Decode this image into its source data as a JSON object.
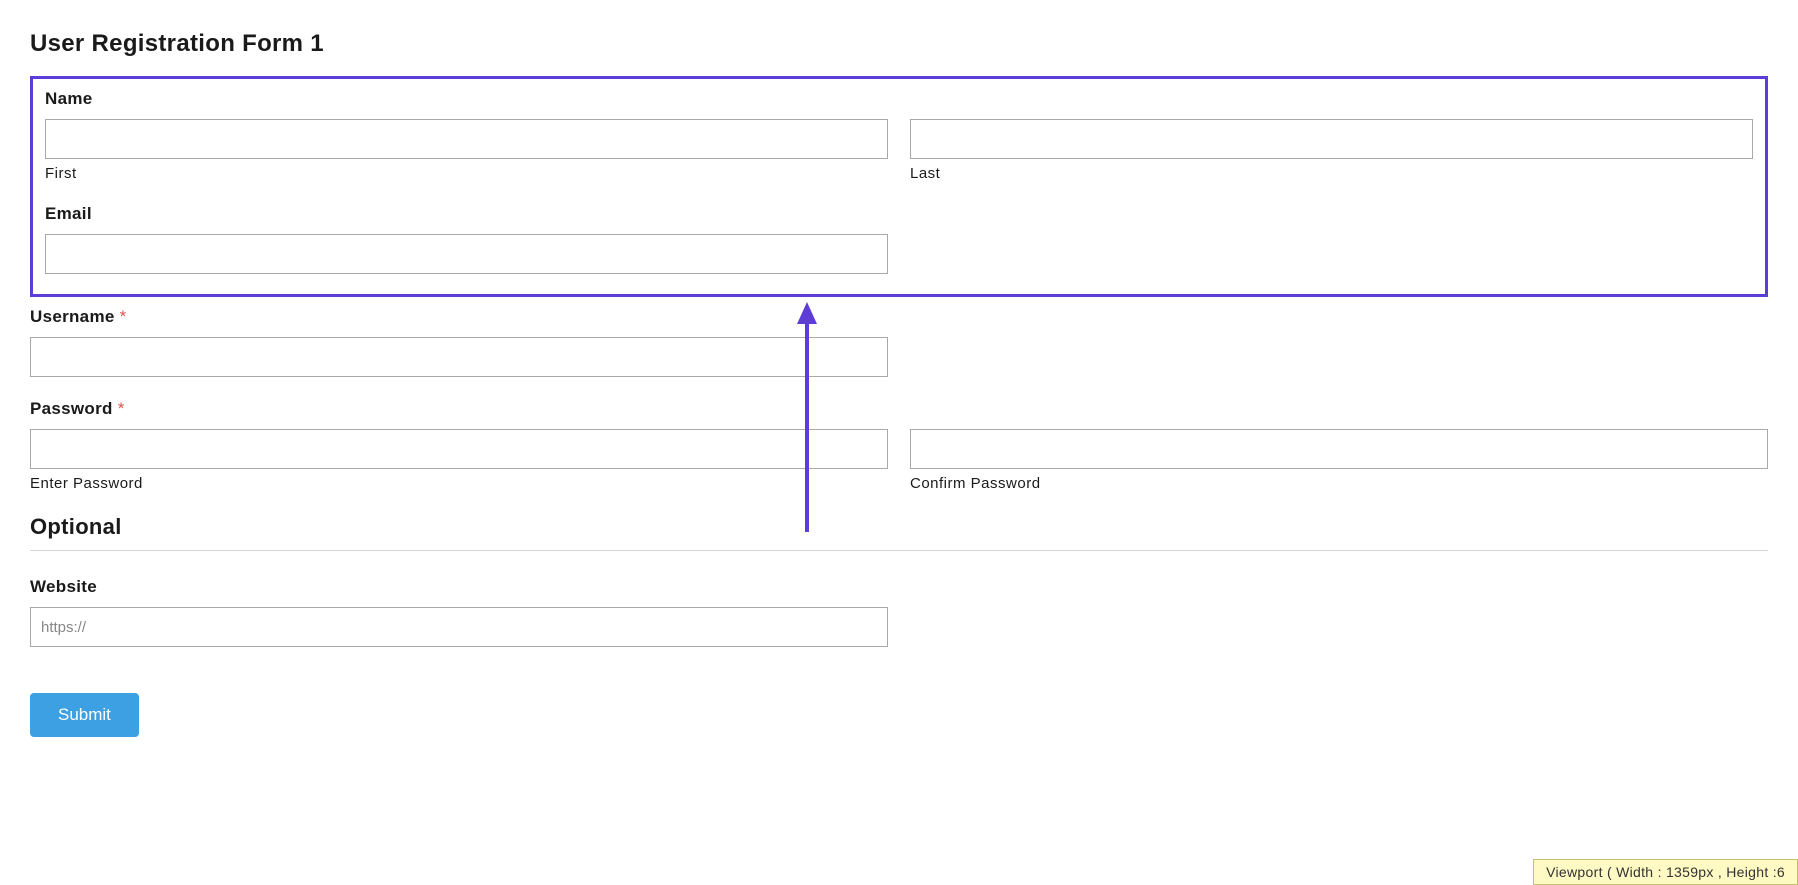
{
  "form": {
    "title": "User Registration Form 1",
    "name": {
      "label": "Name",
      "first_sublabel": "First",
      "last_sublabel": "Last",
      "first_value": "",
      "last_value": ""
    },
    "email": {
      "label": "Email",
      "value": ""
    },
    "username": {
      "label": "Username ",
      "required_mark": "*",
      "value": ""
    },
    "password": {
      "label": "Password ",
      "required_mark": "*",
      "enter_sublabel": "Enter Password",
      "confirm_sublabel": "Confirm Password",
      "enter_value": "",
      "confirm_value": ""
    },
    "optional_heading": "Optional",
    "website": {
      "label": "Website",
      "placeholder": "https://",
      "value": ""
    },
    "submit_label": "Submit"
  },
  "viewport_badge": "Viewport ( Width : 1359px , Height :6"
}
